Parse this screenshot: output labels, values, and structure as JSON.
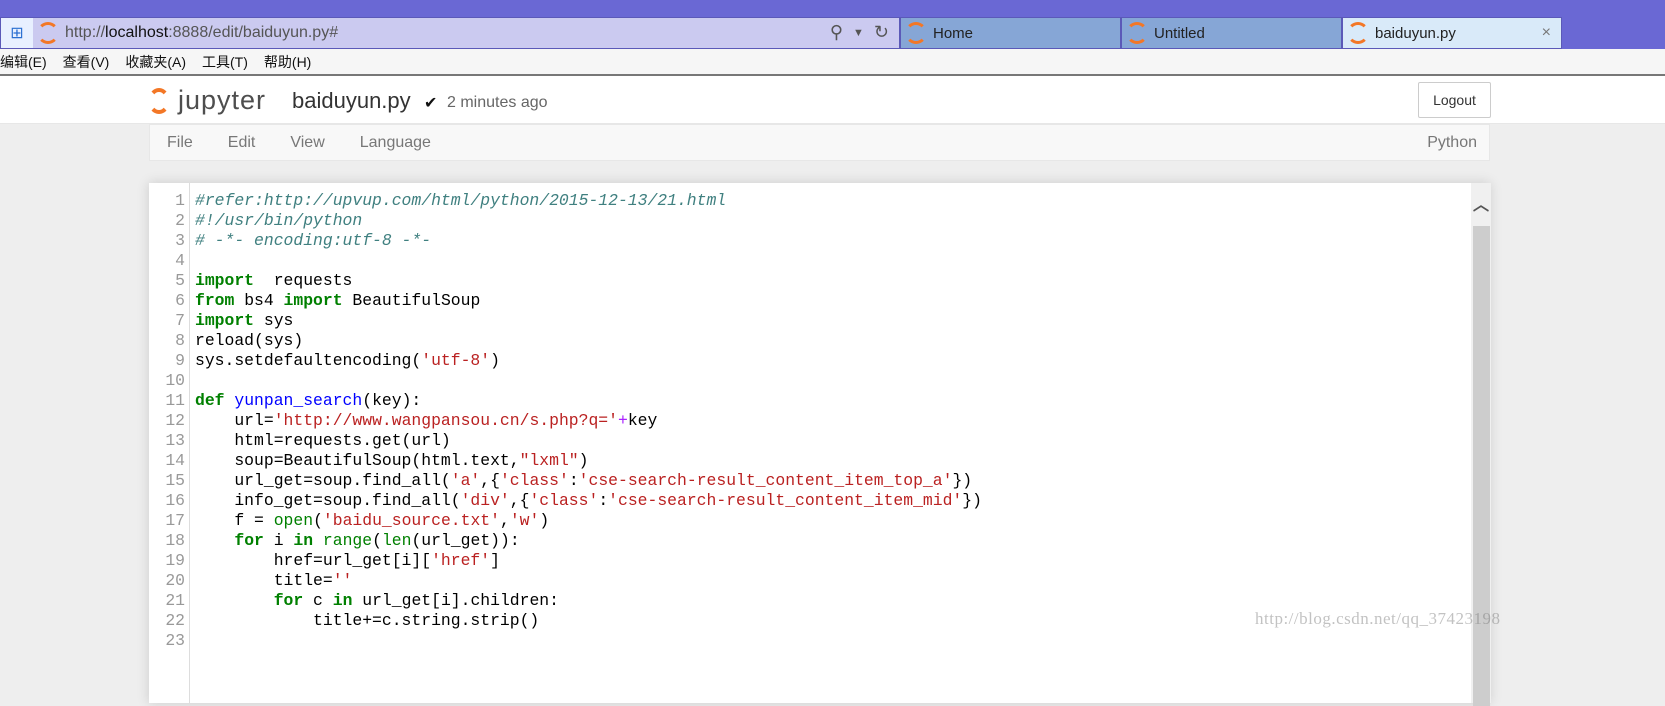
{
  "browser": {
    "address_url_prefix": "http://",
    "address_url_host": "localhost",
    "address_url_rest": ":8888/edit/baiduyun.py#",
    "tabs": [
      {
        "label": "Home"
      },
      {
        "label": "Untitled"
      },
      {
        "label": "baiduyun.py",
        "active": true
      }
    ],
    "menu": [
      "编辑(E)",
      "查看(V)",
      "收藏夹(A)",
      "工具(T)",
      "帮助(H)"
    ],
    "close": "×"
  },
  "header": {
    "logo": "jupyter",
    "filename": "baiduyun.py",
    "check": "✔",
    "saved": "2 minutes ago",
    "logout": "Logout"
  },
  "menubar": {
    "items": [
      "File",
      "Edit",
      "View",
      "Language"
    ],
    "kernel": "Python"
  },
  "colors": {
    "accent": "#f37726",
    "keyword": "#008000",
    "string": "#ba2121",
    "comment": "#408080",
    "def": "#0000ff"
  },
  "code": [
    [
      [
        "com",
        "#refer:http://upvup.com/html/python/2015-12-13/21.html"
      ]
    ],
    [
      [
        "com",
        "#!/usr/bin/python"
      ]
    ],
    [
      [
        "com",
        "# -*- encoding:utf-8 -*-"
      ]
    ],
    [],
    [
      [
        "kw",
        "import"
      ],
      [
        "",
        "  requests"
      ]
    ],
    [
      [
        "kw",
        "from"
      ],
      [
        "",
        " bs4 "
      ],
      [
        "kw",
        "import"
      ],
      [
        "",
        " BeautifulSoup"
      ]
    ],
    [
      [
        "kw",
        "import"
      ],
      [
        "",
        " sys"
      ]
    ],
    [
      [
        "",
        "reload(sys)"
      ]
    ],
    [
      [
        "",
        "sys.setdefaultencoding("
      ],
      [
        "str",
        "'utf-8'"
      ],
      [
        "",
        ")"
      ]
    ],
    [],
    [
      [
        "kw",
        "def"
      ],
      [
        "",
        " "
      ],
      [
        "def",
        "yunpan_search"
      ],
      [
        "",
        "(key):"
      ]
    ],
    [
      [
        "",
        "    url="
      ],
      [
        "str",
        "'http://www.wangpansou.cn/s.php?q='"
      ],
      [
        "op",
        "+"
      ],
      [
        "",
        "key"
      ]
    ],
    [
      [
        "",
        "    html=requests.get(url)"
      ]
    ],
    [
      [
        "",
        "    soup=BeautifulSoup(html.text,"
      ],
      [
        "str",
        "\"lxml\""
      ],
      [
        "",
        ")"
      ]
    ],
    [
      [
        "",
        "    url_get=soup.find_all("
      ],
      [
        "str",
        "'a'"
      ],
      [
        "",
        ",{"
      ],
      [
        "str",
        "'class'"
      ],
      [
        "",
        ":"
      ],
      [
        "str",
        "'cse-search-result_content_item_top_a'"
      ],
      [
        "",
        "})"
      ]
    ],
    [
      [
        "",
        "    info_get=soup.find_all("
      ],
      [
        "str",
        "'div'"
      ],
      [
        "",
        ",{"
      ],
      [
        "str",
        "'class'"
      ],
      [
        "",
        ":"
      ],
      [
        "str",
        "'cse-search-result_content_item_mid'"
      ],
      [
        "",
        "})"
      ]
    ],
    [
      [
        "",
        "    f = "
      ],
      [
        "bi",
        "open"
      ],
      [
        "",
        "("
      ],
      [
        "str",
        "'baidu_source.txt'"
      ],
      [
        "",
        ","
      ],
      [
        "str",
        "'w'"
      ],
      [
        "",
        ")"
      ]
    ],
    [
      [
        "",
        "    "
      ],
      [
        "kw",
        "for"
      ],
      [
        "",
        " i "
      ],
      [
        "kw",
        "in"
      ],
      [
        "",
        " "
      ],
      [
        "bi",
        "range"
      ],
      [
        "",
        "("
      ],
      [
        "bi",
        "len"
      ],
      [
        "",
        "(url_get)):"
      ]
    ],
    [
      [
        "",
        "        href=url_get[i]["
      ],
      [
        "str",
        "'href'"
      ],
      [
        "",
        "]"
      ]
    ],
    [
      [
        "",
        "        title="
      ],
      [
        "str",
        "''"
      ]
    ],
    [
      [
        "",
        "        "
      ],
      [
        "kw",
        "for"
      ],
      [
        "",
        " c "
      ],
      [
        "kw",
        "in"
      ],
      [
        "",
        " url_get[i].children:"
      ]
    ],
    [
      [
        "",
        "            title+=c.string.strip()"
      ]
    ],
    []
  ],
  "watermark": "http://blog.csdn.net/qq_37423198"
}
